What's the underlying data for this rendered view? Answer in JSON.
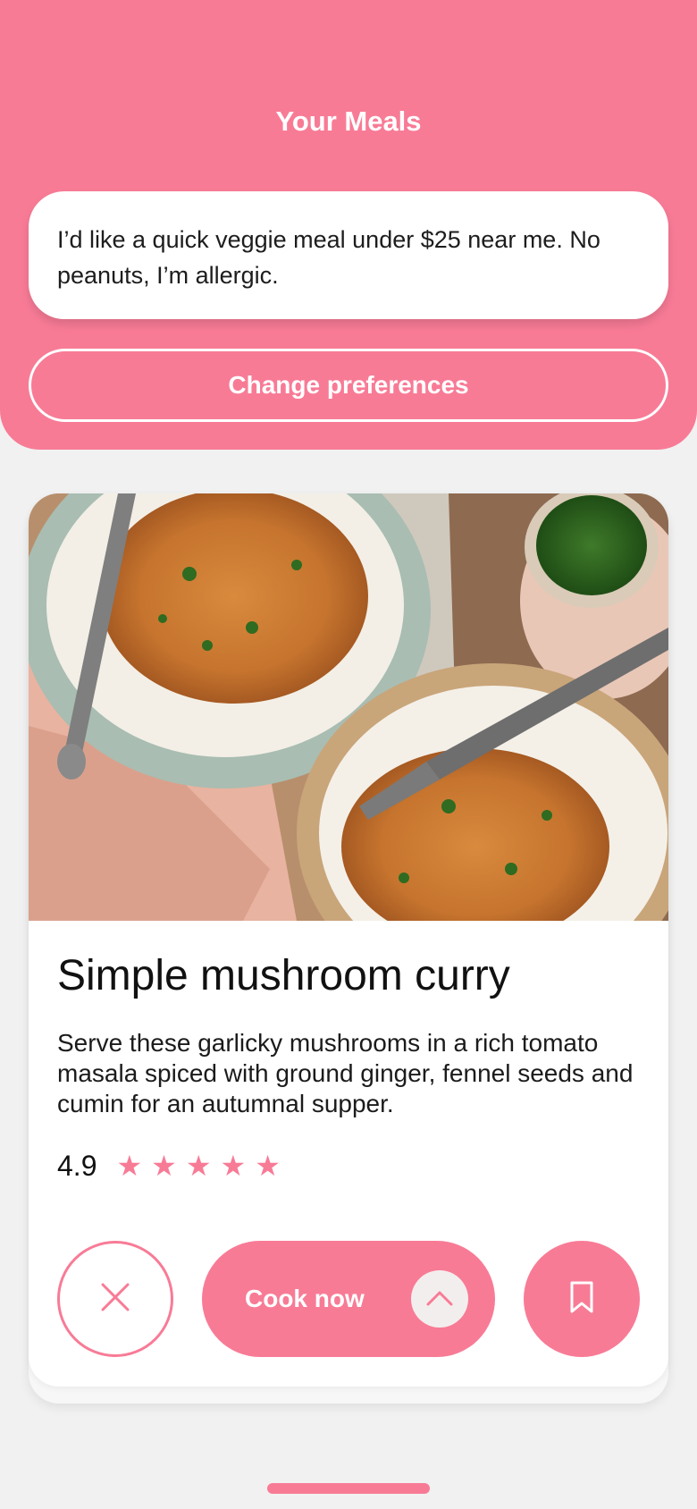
{
  "header": {
    "title": "Your Meals",
    "prompt": "I’d like a quick veggie meal under $25 near me. No peanuts, I’m allergic.",
    "change_preferences_label": "Change preferences"
  },
  "recipe": {
    "title": "Simple mushroom curry",
    "description": "Serve these garlicky mushrooms in a rich tomato masala spiced with ground ginger, fennel seeds and cumin for an autumnal supper.",
    "rating": "4.9",
    "stars": 5
  },
  "actions": {
    "dismiss_icon": "close-icon",
    "cook_label": "Cook now",
    "cook_icon": "chevron-up-icon",
    "save_icon": "bookmark-icon"
  },
  "colors": {
    "accent": "#f87b96",
    "background": "#f1f1f1",
    "card": "#ffffff"
  }
}
